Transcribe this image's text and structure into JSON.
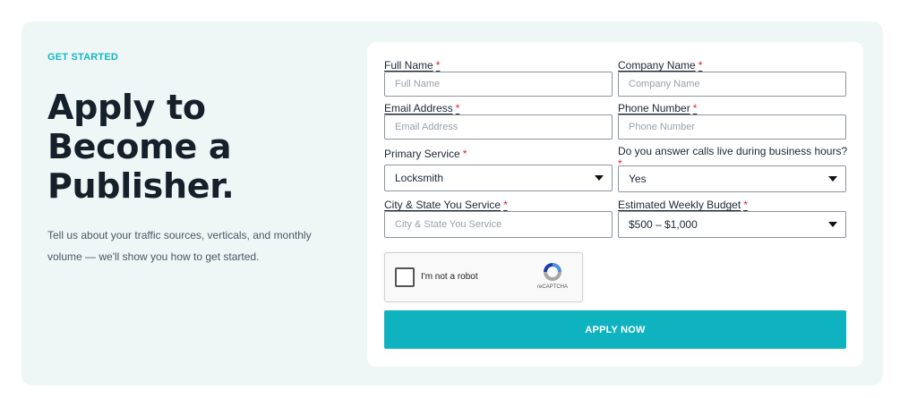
{
  "hero": {
    "eyebrow": "GET STARTED",
    "headline": "Apply to Become a Publisher.",
    "description": "Tell us about your traffic sources, verticals, and monthly volume — we'll show you how to get started."
  },
  "form": {
    "required_mark": "*",
    "full_name": {
      "label": "Full Name",
      "placeholder": "Full Name"
    },
    "company_name": {
      "label": "Company Name",
      "placeholder": "Company Name"
    },
    "email": {
      "label": "Email Address",
      "placeholder": "Email Address"
    },
    "phone": {
      "label": "Phone Number",
      "placeholder": "Phone Number"
    },
    "primary_service": {
      "label": "Primary Service",
      "value": "Locksmith"
    },
    "live_calls": {
      "label": "Do you answer calls live during business hours?",
      "value": "Yes"
    },
    "city_state": {
      "label": "City & State You Service",
      "placeholder": "City & State You Service"
    },
    "budget": {
      "label": "Estimated Weekly Budget",
      "value": "$500 – $1,000"
    },
    "captcha": {
      "text": "I'm not a robot",
      "brand": "reCAPTCHA"
    },
    "submit_label": "APPLY NOW"
  },
  "colors": {
    "accent": "#0fb3bf",
    "required": "#e0202c",
    "panel": "#eef6f6"
  },
  "icons": {
    "select_arrow": "caret-down-icon",
    "captcha_logo": "recaptcha-icon"
  }
}
